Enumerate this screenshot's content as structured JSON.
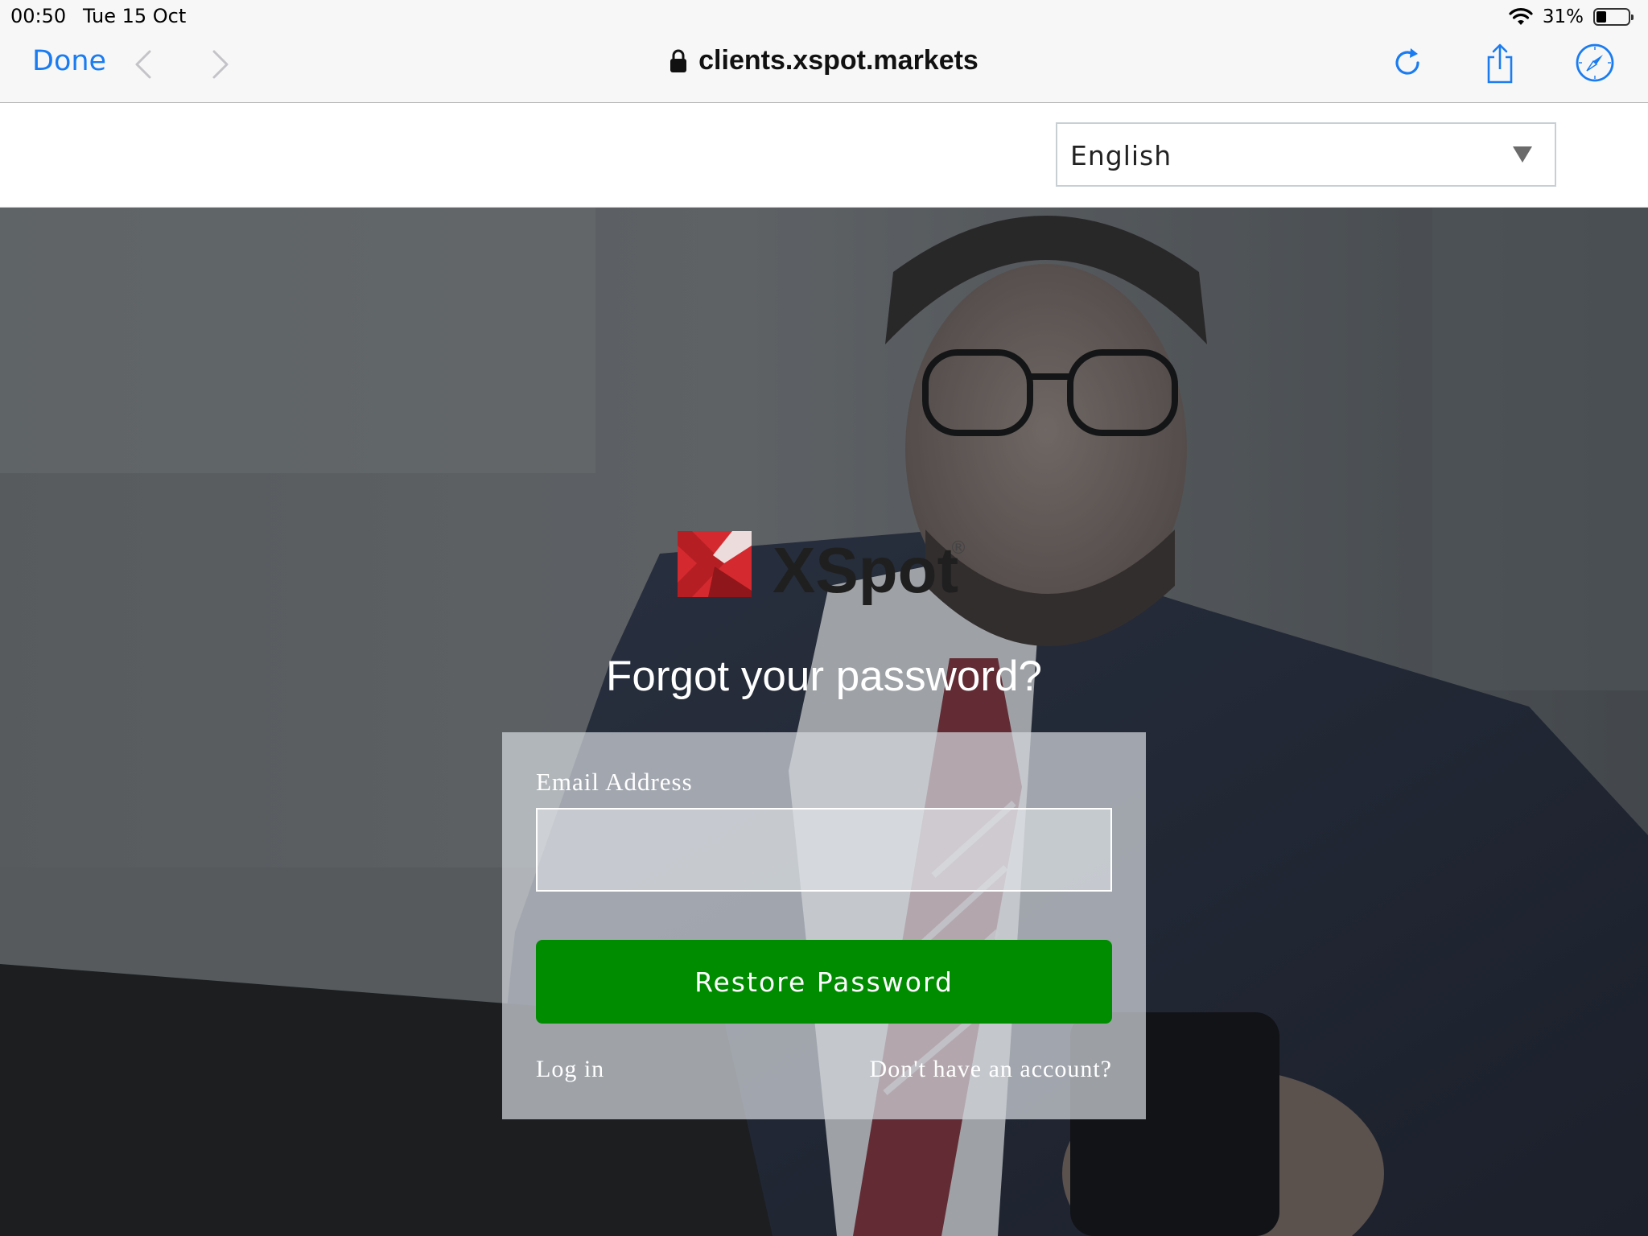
{
  "status_bar": {
    "time": "00:50",
    "date": "Tue 15 Oct",
    "battery_percent": "31%",
    "battery_level": 0.31
  },
  "browser": {
    "done_label": "Done",
    "url": "clients.xspot.markets",
    "accent_color": "#1a7cf0"
  },
  "language": {
    "selected": "English"
  },
  "logo": {
    "text": "XSpot",
    "mark": "®",
    "brand_color": "#d42a2f"
  },
  "page": {
    "title": "Forgot your password?"
  },
  "form": {
    "email_label": "Email Address",
    "email_value": "",
    "submit_label": "Restore Password",
    "submit_color": "#008c00",
    "login_link": "Log in",
    "signup_link": "Don't have an account?"
  }
}
